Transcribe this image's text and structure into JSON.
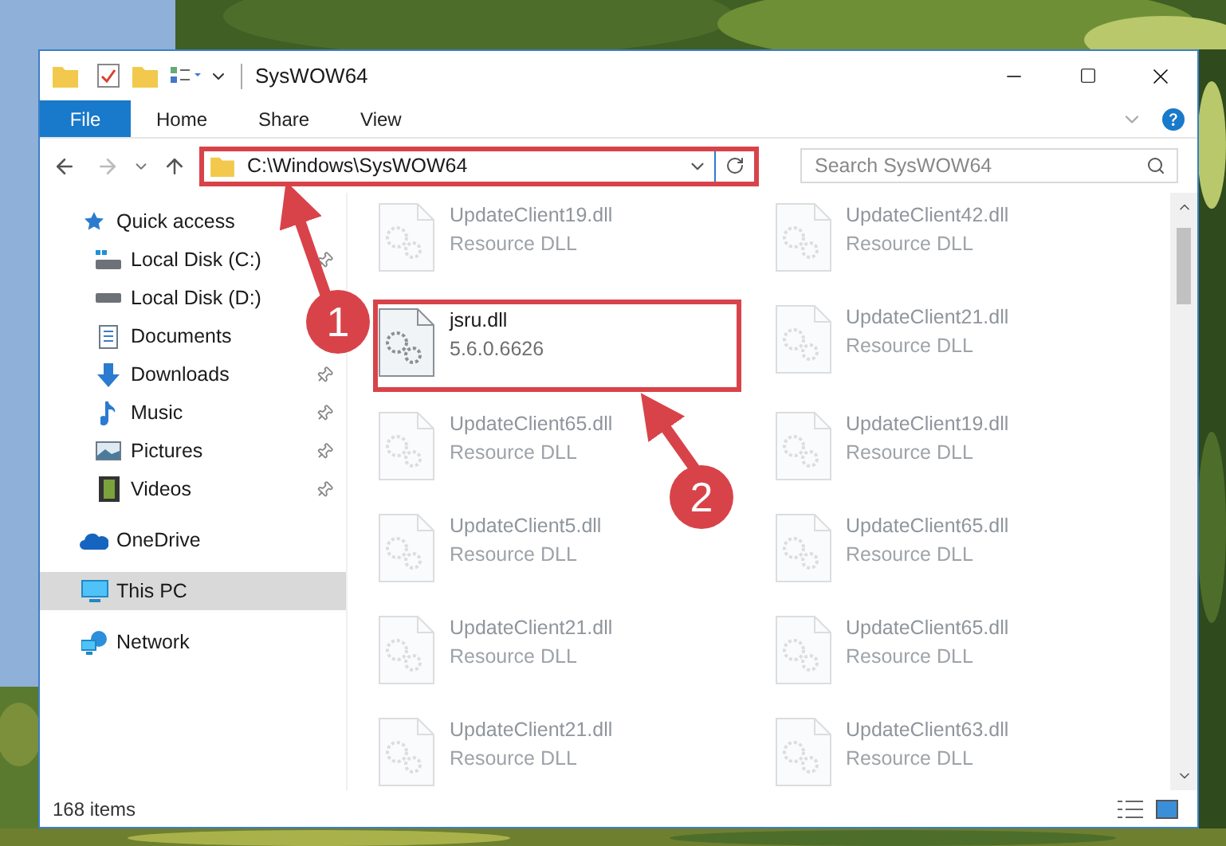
{
  "window": {
    "title": "SysWOW64"
  },
  "ribbon": {
    "tabs": [
      {
        "label": "File",
        "selected": true
      },
      {
        "label": "Home",
        "selected": false
      },
      {
        "label": "Share",
        "selected": false
      },
      {
        "label": "View",
        "selected": false
      }
    ]
  },
  "address_bar": {
    "path": "C:\\Windows\\SysWOW64",
    "highlighted": true
  },
  "search": {
    "placeholder": "Search SysWOW64"
  },
  "sidebar": {
    "items": [
      {
        "label": "Quick access",
        "kind": "quick",
        "pinned": false,
        "selected": false,
        "children": [
          {
            "label": "Local Disk (C:)",
            "kind": "disk-c",
            "pinned": true,
            "selected": false
          },
          {
            "label": "Local Disk (D:)",
            "kind": "disk",
            "pinned": false,
            "selected": false
          },
          {
            "label": "Documents",
            "kind": "documents",
            "pinned": false,
            "selected": false
          },
          {
            "label": "Downloads",
            "kind": "downloads",
            "pinned": true,
            "selected": false
          },
          {
            "label": "Music",
            "kind": "music",
            "pinned": true,
            "selected": false
          },
          {
            "label": "Pictures",
            "kind": "pictures",
            "pinned": true,
            "selected": false
          },
          {
            "label": "Videos",
            "kind": "videos",
            "pinned": true,
            "selected": false
          }
        ]
      },
      {
        "label": "OneDrive",
        "kind": "cloud",
        "pinned": false,
        "selected": false
      },
      {
        "label": "This PC",
        "kind": "pc",
        "pinned": false,
        "selected": true
      },
      {
        "label": "Network",
        "kind": "network",
        "pinned": false,
        "selected": false
      }
    ]
  },
  "files": [
    {
      "name": "UpdateClient19.dll",
      "detail": "Resource DLL",
      "highlighted": false
    },
    {
      "name": "UpdateClient42.dll",
      "detail": "Resource DLL",
      "highlighted": false
    },
    {
      "name": "jsru.dll",
      "detail": "5.6.0.6626",
      "highlighted": true
    },
    {
      "name": "UpdateClient21.dll",
      "detail": "Resource DLL",
      "highlighted": false
    },
    {
      "name": "UpdateClient65.dll",
      "detail": "Resource DLL",
      "highlighted": false
    },
    {
      "name": "UpdateClient19.dll",
      "detail": "Resource DLL",
      "highlighted": false
    },
    {
      "name": "UpdateClient5.dll",
      "detail": "Resource DLL",
      "highlighted": false
    },
    {
      "name": "UpdateClient65.dll",
      "detail": "Resource DLL",
      "highlighted": false
    },
    {
      "name": "UpdateClient21.dll",
      "detail": "Resource DLL",
      "highlighted": false
    },
    {
      "name": "UpdateClient65.dll",
      "detail": "Resource DLL",
      "highlighted": false
    },
    {
      "name": "UpdateClient21.dll",
      "detail": "Resource DLL",
      "highlighted": false
    },
    {
      "name": "UpdateClient63.dll",
      "detail": "Resource DLL",
      "highlighted": false
    }
  ],
  "status_bar": {
    "count": "168 items"
  },
  "annotations": [
    {
      "label": "1"
    },
    {
      "label": "2"
    }
  ]
}
